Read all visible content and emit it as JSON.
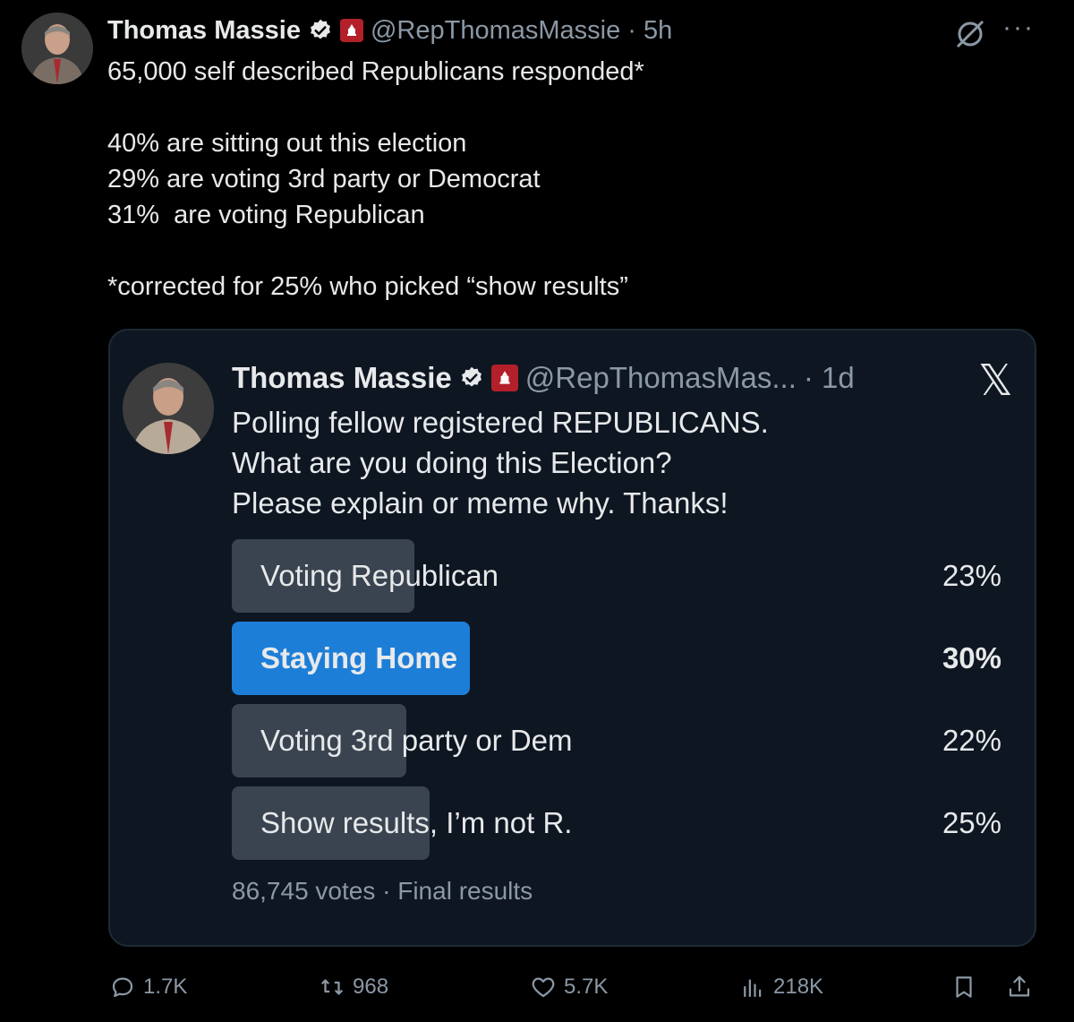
{
  "tweet": {
    "author_name": "Thomas Massie",
    "handle": "@RepThomasMassie",
    "time": "· 5h",
    "text": "65,000 self described Republicans responded*\n\n40% are sitting out this election\n29% are voting 3rd party or Democrat\n31%  are voting Republican\n\n*corrected for 25% who picked “show results”",
    "more_icon": "···"
  },
  "quote": {
    "author_name": "Thomas Massie",
    "handle": "@RepThomasMas...",
    "time": "· 1d",
    "x_logo": "𝕏",
    "text": "Polling fellow registered REPUBLICANS.\nWhat are you doing this Election?\nPlease explain or meme why. Thanks!",
    "poll": {
      "options": [
        {
          "label": "Voting Republican",
          "pct": "23%",
          "share": 0.23,
          "winner": false
        },
        {
          "label": "Staying Home",
          "pct": "30%",
          "share": 0.3,
          "winner": true
        },
        {
          "label": "Voting 3rd party or Dem",
          "pct": "22%",
          "share": 0.22,
          "winner": false
        },
        {
          "label": "Show results, I’m not R.",
          "pct": "25%",
          "share": 0.25,
          "winner": false
        }
      ],
      "meta": "86,745 votes · Final results"
    }
  },
  "actions": {
    "replies": "1.7K",
    "reposts": "968",
    "likes": "5.7K",
    "views": "218K"
  },
  "colors": {
    "background": "#000000",
    "card": "#0e1622",
    "winner_bar": "#1d7ed8",
    "bar": "#3a4450",
    "muted": "#8b98a5",
    "verified": "#1d9bf0",
    "gop": "#b3202a"
  }
}
